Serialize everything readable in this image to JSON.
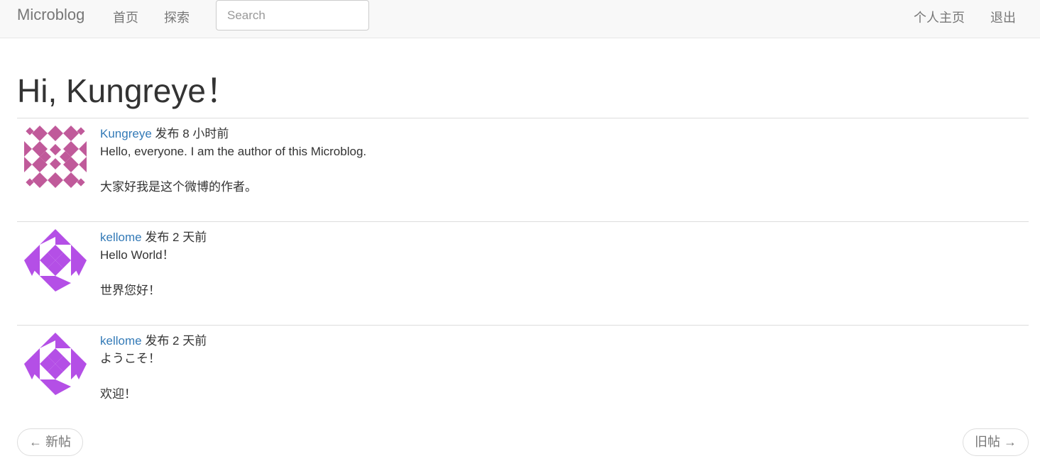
{
  "navbar": {
    "brand": "Microblog",
    "links": {
      "home": "首页",
      "explore": "探索",
      "profile": "个人主页",
      "logout": "退出"
    },
    "search": {
      "placeholder": "Search",
      "value": ""
    }
  },
  "greeting": "Hi, Kungreye！",
  "posts": [
    {
      "author": "Kungreye",
      "meta": " 发布 8 小时前",
      "lines": [
        "Hello, everyone. I am the author of this Microblog.",
        "大家好我是这个微博的作者。"
      ],
      "avatar_color": "#c05a9a"
    },
    {
      "author": "kellome",
      "meta": " 发布 2 天前",
      "lines": [
        "Hello World！",
        "世界您好！"
      ],
      "avatar_color": "#b44fe6"
    },
    {
      "author": "kellome",
      "meta": " 发布 2 天前",
      "lines": [
        "ようこそ！",
        "欢迎！"
      ],
      "avatar_color": "#b44fe6"
    }
  ],
  "pager": {
    "newer": "← 新帖",
    "older": "旧帖 →"
  }
}
